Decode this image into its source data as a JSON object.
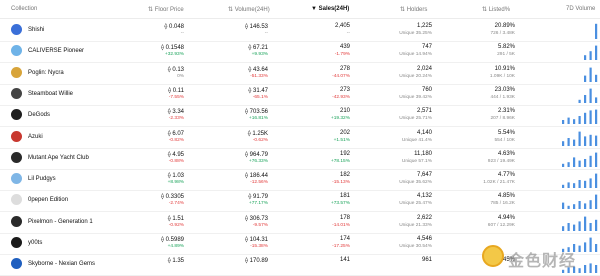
{
  "header": {
    "collection": "Collection",
    "floor_price": "Floor Price",
    "volume": "Volume(24H)",
    "sales": "Sales(24H)",
    "holders": "Holders",
    "listed": "Listed%",
    "volume_7d": "7D Volume"
  },
  "rows": [
    {
      "name": "Shishi",
      "avatar_color": "#3a6fd8",
      "floor": "⟠ 0.048",
      "floor_chg": "--",
      "floor_dir": "flat",
      "vol": "⟠ 146.53",
      "vol_chg": "--",
      "vol_dir": "flat",
      "sales": "2,405",
      "sales_chg": "--",
      "sales_dir": "flat",
      "holders": "1,225",
      "holders_sub": "Unique 35.25%",
      "listed": "20.89%",
      "listed_sub": "726 / 3.48K",
      "bars": [
        0,
        0,
        0,
        0,
        0,
        0,
        0.95
      ]
    },
    {
      "name": "CALIVERSE Pioneer",
      "avatar_color": "#6fb3e8",
      "floor": "⟠ 0.1548",
      "floor_chg": "+32.93%",
      "floor_dir": "up",
      "vol": "⟠ 67.21",
      "vol_chg": "+9.93%",
      "vol_dir": "up",
      "sales": "439",
      "sales_chg": "-1.79%",
      "sales_dir": "down",
      "holders": "747",
      "holders_sub": "Unique 14.94%",
      "listed": "5.82%",
      "listed_sub": "291 / 5K",
      "bars": [
        0,
        0,
        0,
        0,
        0.3,
        0.55,
        0.9
      ]
    },
    {
      "name": "Poglin: Nycra",
      "avatar_color": "#d8a43a",
      "floor": "⟠ 0.13",
      "floor_chg": "0%",
      "floor_dir": "flat",
      "vol": "⟠ 43.64",
      "vol_chg": "-51.33%",
      "vol_dir": "down",
      "sales": "278",
      "sales_chg": "-44.07%",
      "sales_dir": "down",
      "holders": "2,024",
      "holders_sub": "Unique 20.24%",
      "listed": "10.91%",
      "listed_sub": "1.09K / 10K",
      "bars": [
        0,
        0,
        0,
        0,
        0.4,
        0.9,
        0.45
      ]
    },
    {
      "name": "Steamboat Willie",
      "avatar_color": "#444444",
      "floor": "⟠ 0.11",
      "floor_chg": "-7.55%",
      "floor_dir": "down",
      "vol": "⟠ 31.47",
      "vol_chg": "-65.1%",
      "vol_dir": "down",
      "sales": "273",
      "sales_chg": "-42.93%",
      "sales_dir": "down",
      "holders": "760",
      "holders_sub": "Unique 39.42%",
      "listed": "23.03%",
      "listed_sub": "444 / 1.93K",
      "bars": [
        0,
        0,
        0,
        0.2,
        0.5,
        0.9,
        0.35
      ]
    },
    {
      "name": "DeGods",
      "avatar_color": "#1e1e1e",
      "floor": "⟠ 3.34",
      "floor_chg": "-2.33%",
      "floor_dir": "down",
      "vol": "⟠ 703.56",
      "vol_chg": "+16.81%",
      "vol_dir": "up",
      "sales": "210",
      "sales_chg": "+19.32%",
      "sales_dir": "up",
      "holders": "2,571",
      "holders_sub": "Unique 25.71%",
      "listed": "2.31%",
      "listed_sub": "207 / 8.96K",
      "bars": [
        0.25,
        0.4,
        0.3,
        0.5,
        0.7,
        0.85,
        0.9
      ]
    },
    {
      "name": "Azuki",
      "avatar_color": "#c8382f",
      "floor": "⟠ 6.07",
      "floor_chg": "-0.82%",
      "floor_dir": "down",
      "vol": "⟠ 1.25K",
      "vol_chg": "-0.62%",
      "vol_dir": "down",
      "sales": "202",
      "sales_chg": "+1.51%",
      "sales_dir": "up",
      "holders": "4,140",
      "holders_sub": "Unique 41.4%",
      "listed": "5.54%",
      "listed_sub": "554 / 10K",
      "bars": [
        0.3,
        0.5,
        0.4,
        0.9,
        0.6,
        0.7,
        0.65
      ]
    },
    {
      "name": "Mutant Ape Yacht Club",
      "avatar_color": "#2a2a2a",
      "floor": "⟠ 4.95",
      "floor_chg": "-0.88%",
      "floor_dir": "down",
      "vol": "⟠ 964.79",
      "vol_chg": "+76.33%",
      "vol_dir": "up",
      "sales": "192",
      "sales_chg": "+78.15%",
      "sales_dir": "up",
      "holders": "11,180",
      "holders_sub": "Unique 57.1%",
      "listed": "4.63%",
      "listed_sub": "923 / 19.49K",
      "bars": [
        0.2,
        0.3,
        0.6,
        0.4,
        0.5,
        0.7,
        0.9
      ]
    },
    {
      "name": "Lil Pudgys",
      "avatar_color": "#7fb6e6",
      "floor": "⟠ 1.03",
      "floor_chg": "+8.98%",
      "floor_dir": "up",
      "vol": "⟠ 186.44",
      "vol_chg": "-12.56%",
      "vol_dir": "down",
      "sales": "182",
      "sales_chg": "-15.13%",
      "sales_dir": "down",
      "holders": "7,647",
      "holders_sub": "Unique 35.62%",
      "listed": "4.77%",
      "listed_sub": "1.02K / 21.47K",
      "bars": [
        0.2,
        0.35,
        0.3,
        0.5,
        0.45,
        0.6,
        0.9
      ]
    },
    {
      "name": "0pepen Edition",
      "avatar_color": "#dddddd",
      "floor": "⟠ 0.3305",
      "floor_chg": "-2.74%",
      "floor_dir": "down",
      "vol": "⟠ 91.79",
      "vol_chg": "+77.17%",
      "vol_dir": "up",
      "sales": "181",
      "sales_chg": "+73.57%",
      "sales_dir": "up",
      "holders": "4,132",
      "holders_sub": "Unique 25.47%",
      "listed": "4.85%",
      "listed_sub": "785 / 16.2K",
      "bars": [
        0.4,
        0.2,
        0.3,
        0.5,
        0.35,
        0.55,
        0.9
      ]
    },
    {
      "name": "Pixelmon - Generation 1",
      "avatar_color": "#2a2a2a",
      "floor": "⟠ 1.51",
      "floor_chg": "-0.92%",
      "floor_dir": "down",
      "vol": "⟠ 306.73",
      "vol_chg": "-9.57%",
      "vol_dir": "down",
      "sales": "178",
      "sales_chg": "-14.01%",
      "sales_dir": "down",
      "holders": "2,622",
      "holders_sub": "Unique 21.33%",
      "listed": "4.94%",
      "listed_sub": "607 / 12.29K",
      "bars": [
        0.3,
        0.5,
        0.4,
        0.6,
        0.9,
        0.5,
        0.7
      ]
    },
    {
      "name": "y00ts",
      "avatar_color": "#1a1a1a",
      "floor": "⟠ 0.5989",
      "floor_chg": "+4.89%",
      "floor_dir": "up",
      "vol": "⟠ 104.31",
      "vol_chg": "-15.38%",
      "vol_dir": "down",
      "sales": "174",
      "sales_chg": "-17.25%",
      "sales_dir": "down",
      "holders": "4,546",
      "holders_sub": "Unique 30.54%",
      "listed": "",
      "listed_sub": "",
      "bars": [
        0.2,
        0.3,
        0.5,
        0.4,
        0.6,
        0.9,
        0.5
      ]
    },
    {
      "name": "Skyborne - Nexian Gems",
      "avatar_color": "#1f5fbf",
      "floor": "⟠ 1.35",
      "floor_chg": "",
      "floor_dir": "up",
      "vol": "⟠ 170.89",
      "vol_chg": "",
      "vol_dir": "up",
      "sales": "141",
      "sales_chg": "",
      "sales_dir": "up",
      "holders": "961",
      "holders_sub": "",
      "listed": "3.45%",
      "listed_sub": "",
      "bars": [
        0.2,
        0.35,
        0.4,
        0.3,
        0.5,
        0.6,
        0.5
      ]
    }
  ],
  "watermark": {
    "text": "金色财经"
  },
  "colors": {
    "up": "#1aa35a",
    "down": "#e23b3b",
    "spark": "#4a8fe0"
  }
}
